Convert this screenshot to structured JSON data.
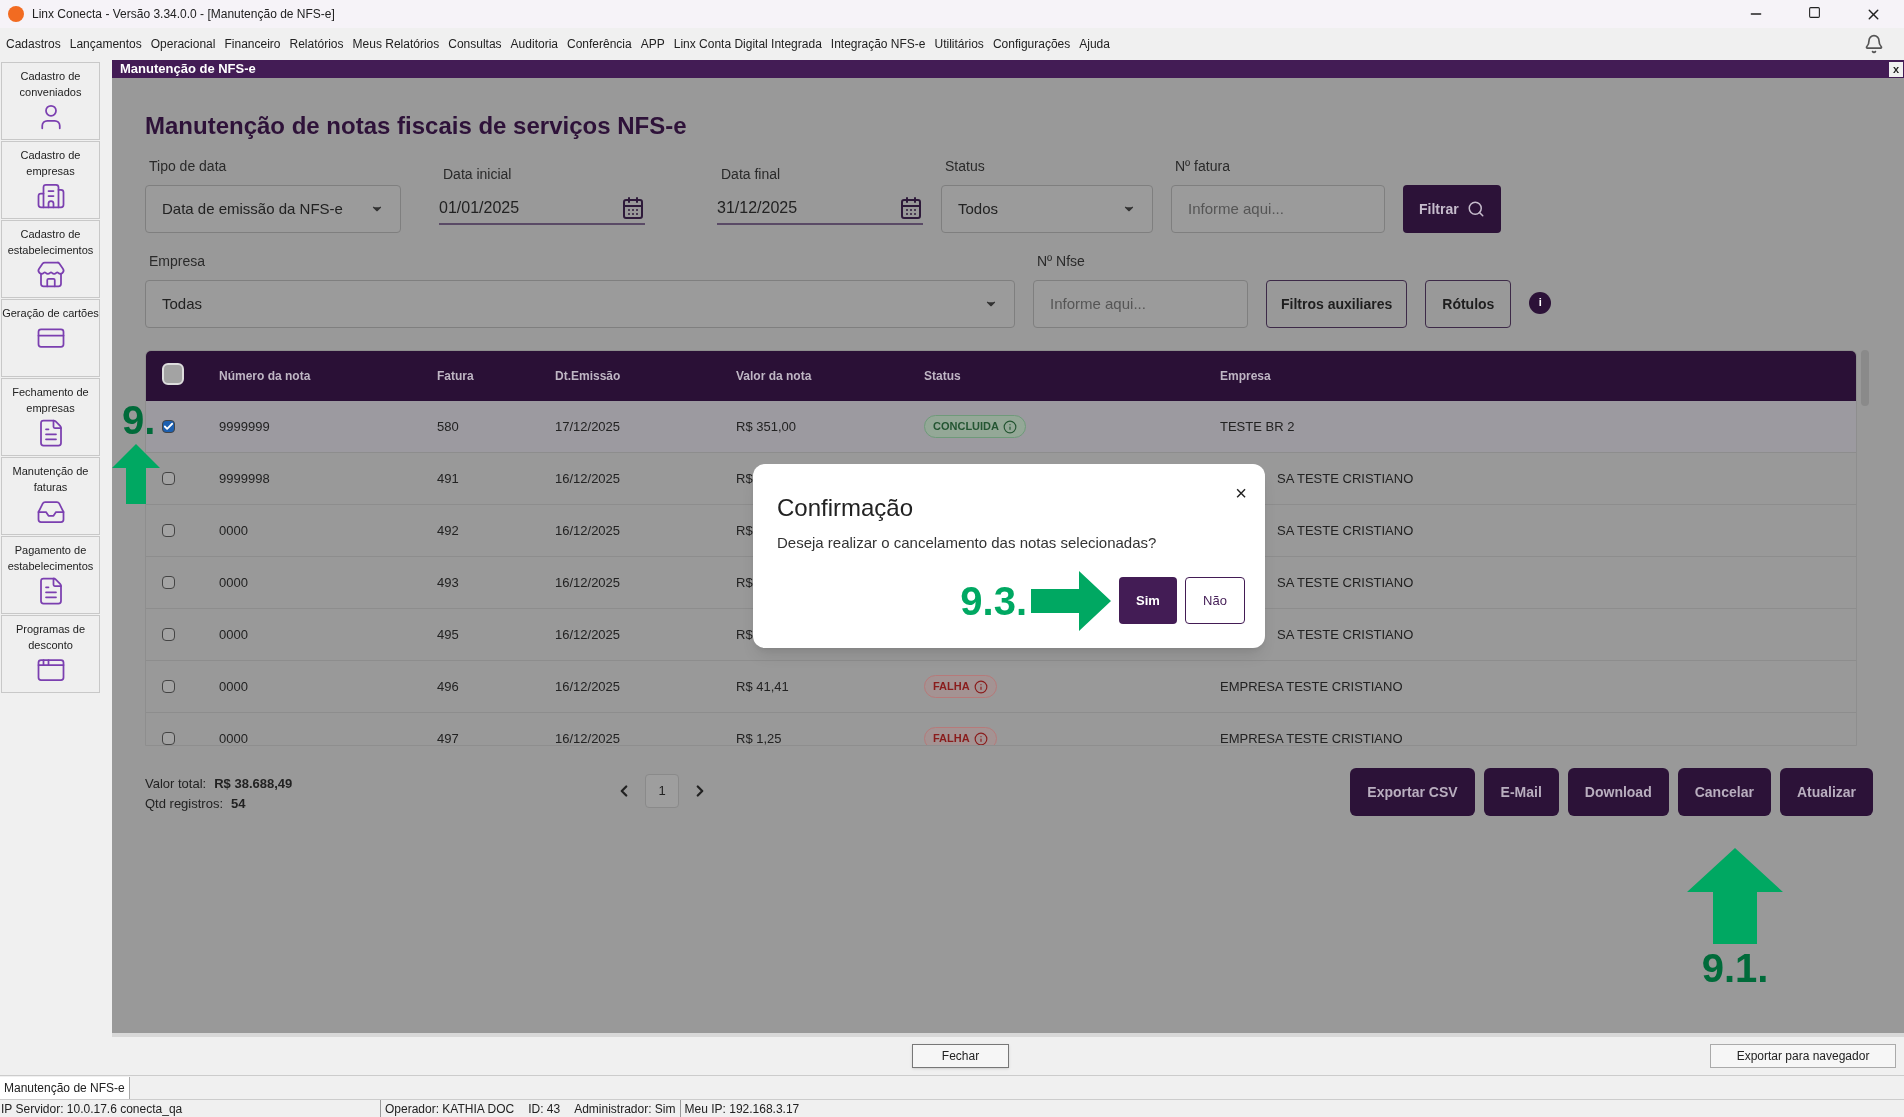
{
  "window": {
    "title": "Linx Conecta - Versão 3.34.0.0 - [Manutenção de NFS-e]"
  },
  "menu": [
    "Cadastros",
    "Lançamentos",
    "Operacional",
    "Financeiro",
    "Relatórios",
    "Meus Relatórios",
    "Consultas",
    "Auditoria",
    "Conferência",
    "APP",
    "Linx Conta Digital Integrada",
    "Integração NFS-e",
    "Utilitários",
    "Configurações",
    "Ajuda"
  ],
  "sidebar": [
    {
      "label": "Cadastro de conveniados",
      "kind": "person"
    },
    {
      "label": "Cadastro de empresas",
      "kind": "building"
    },
    {
      "label": "Cadastro de estabelecimentos",
      "kind": "store"
    },
    {
      "label": "Geração de cartões",
      "kind": "card"
    },
    {
      "label": "Fechamento de empresas",
      "kind": "bill-plus"
    },
    {
      "label": "Manutenção de faturas",
      "kind": "tray"
    },
    {
      "label": "Pagamento de estabelecimentos",
      "kind": "bill-minus"
    },
    {
      "label": "Programas de desconto",
      "kind": "window"
    }
  ],
  "inner_window": {
    "title": "Manutenção de NFS-e",
    "close": "x"
  },
  "page": {
    "heading": "Manutenção de notas fiscais de serviços NFS-e"
  },
  "filters": {
    "tipo_de_data": {
      "label": "Tipo de data",
      "value": "Data de emissão da NFS-e"
    },
    "data_inicial": {
      "label": "Data inicial",
      "value": "01/01/2025"
    },
    "data_final": {
      "label": "Data final",
      "value": "31/12/2025"
    },
    "status": {
      "label": "Status",
      "value": "Todos"
    },
    "n_fatura": {
      "label": "Nº fatura",
      "placeholder": "Informe aqui..."
    },
    "filter_button": "Filtrar",
    "empresa": {
      "label": "Empresa",
      "value": "Todas"
    },
    "n_nfse": {
      "label": "Nº Nfse",
      "placeholder": "Informe aqui..."
    },
    "aux_button": "Filtros auxiliares",
    "labels_button": "Rótulos",
    "info": "i"
  },
  "table": {
    "select_all": false,
    "columns": [
      "Número da nota",
      "Fatura",
      "Dt.Emissão",
      "Valor da nota",
      "Status",
      "Empresa"
    ],
    "rows": [
      {
        "selected": true,
        "numero": "9999999",
        "fatura": "580",
        "data": "17/12/2025",
        "valor": "R$ 351,00",
        "status": "CONCLUIDA",
        "kind": "ok",
        "empresa": "TESTE BR 2",
        "covered": false
      },
      {
        "selected": false,
        "numero": "9999998",
        "fatura": "491",
        "data": "16/12/2025",
        "valor": "R$",
        "empresa": "SA TESTE CRISTIANO",
        "covered": true
      },
      {
        "selected": false,
        "numero": "0000",
        "fatura": "492",
        "data": "16/12/2025",
        "valor": "R$",
        "empresa": "SA TESTE CRISTIANO",
        "covered": true
      },
      {
        "selected": false,
        "numero": "0000",
        "fatura": "493",
        "data": "16/12/2025",
        "valor": "R$",
        "empresa": "SA TESTE CRISTIANO",
        "covered": true
      },
      {
        "selected": false,
        "numero": "0000",
        "fatura": "495",
        "data": "16/12/2025",
        "valor": "R$",
        "empresa": "SA TESTE CRISTIANO",
        "covered": true
      },
      {
        "selected": false,
        "numero": "0000",
        "fatura": "496",
        "data": "16/12/2025",
        "valor": "R$ 41,41",
        "status": "FALHA",
        "kind": "fail",
        "empresa": "EMPRESA TESTE CRISTIANO",
        "covered": false
      },
      {
        "selected": false,
        "numero": "0000",
        "fatura": "497",
        "data": "16/12/2025",
        "valor": "R$ 1,25",
        "status": "FALHA",
        "kind": "fail",
        "empresa": "EMPRESA TESTE CRISTIANO",
        "covered": false
      }
    ]
  },
  "summary": {
    "total_label": "Valor total:",
    "total": "R$ 38.688,49",
    "count_label": "Qtd registros:",
    "count": "54"
  },
  "pagination": {
    "pages": [
      {
        "label": "1",
        "selected": true
      }
    ]
  },
  "actions": [
    "Exportar CSV",
    "E-Mail",
    "Download",
    "Cancelar",
    "Atualizar"
  ],
  "dialog": {
    "title": "Confirmação",
    "message": "Deseja realizar o cancelamento das notas selecionadas?",
    "close": "×",
    "yes": "Sim",
    "no": "Não"
  },
  "annotations": [
    {
      "label": "9.",
      "kind": "up"
    },
    {
      "label": "9.3.",
      "kind": "right"
    },
    {
      "label": "9.1.",
      "kind": "up"
    }
  ],
  "footer": {
    "close_button": "Fechar",
    "export_button": "Exportar para navegador"
  },
  "task_tab": "Manutenção de NFS-e",
  "status_bar": [
    "IP Servidor: 10.0.17.6 conecta_qa",
    "Operador: KATHIA DOC",
    "ID: 43",
    "Administrador: Sim",
    "Meu IP: 192.168.3.17"
  ]
}
